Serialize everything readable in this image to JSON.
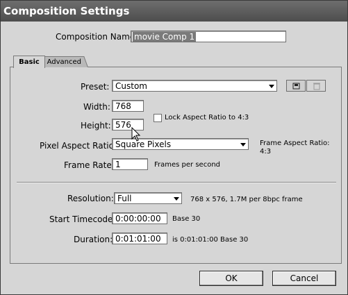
{
  "window": {
    "title": "Composition Settings"
  },
  "comp_name": {
    "label": "Composition Name:",
    "value": "movie Comp 1"
  },
  "tabs": [
    {
      "label": "Basic"
    },
    {
      "label": "Advanced"
    }
  ],
  "preset": {
    "label": "Preset:",
    "value": "Custom"
  },
  "width": {
    "label": "Width:",
    "value": "768"
  },
  "height": {
    "label": "Height:",
    "value": "576"
  },
  "lock_aspect": {
    "label": "Lock Aspect Ratio to 4:3",
    "checked": false
  },
  "pixel_aspect": {
    "label": "Pixel Aspect Ratio:",
    "value": "Square Pixels"
  },
  "frame_aspect": {
    "label": "Frame Aspect Ratio:",
    "value": "4:3"
  },
  "frame_rate": {
    "label": "Frame Rate:",
    "value": "1",
    "suffix": "Frames per second"
  },
  "resolution": {
    "label": "Resolution:",
    "value": "Full",
    "info": "768 x 576, 1.7M per 8bpc frame"
  },
  "start_timecode": {
    "label": "Start Timecode:",
    "value": "0:00:00:00",
    "base": "Base 30"
  },
  "duration": {
    "label": "Duration:",
    "value": "0:01:01:00",
    "info": "is 0:01:01:00  Base 30"
  },
  "buttons": {
    "ok": "OK",
    "cancel": "Cancel"
  },
  "icons": {
    "save_preset": "save-preset-icon",
    "delete_preset": "trash-icon",
    "cursor": "arrow-cursor-icon"
  }
}
